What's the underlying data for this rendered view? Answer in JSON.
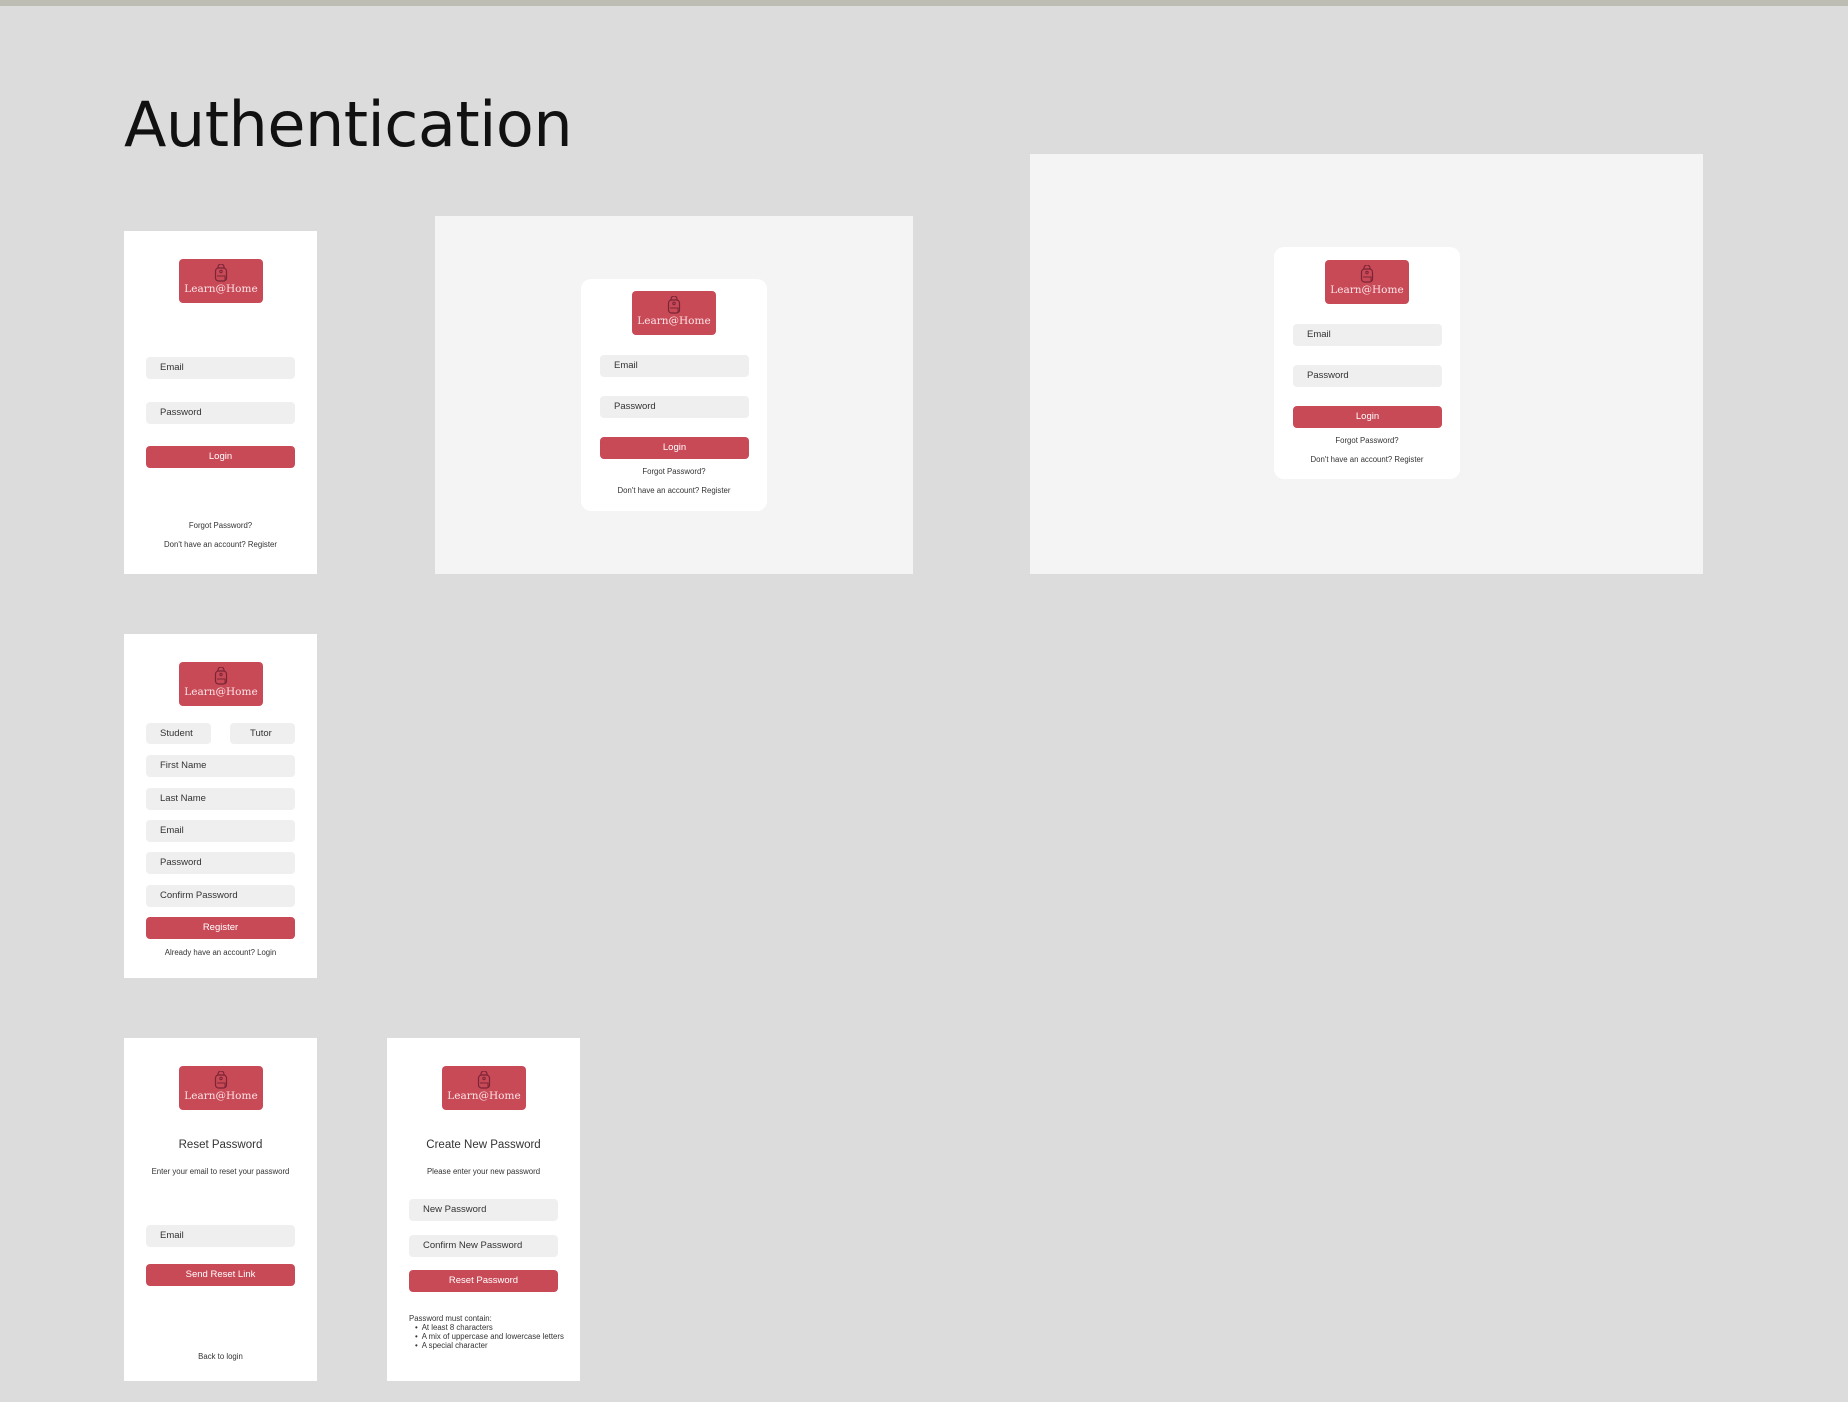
{
  "page_title": "Authentication",
  "brand": {
    "name": "Learn@Home",
    "logo_icon": "backpack-icon",
    "accent": "#c94a57"
  },
  "login": {
    "email_placeholder": "Email",
    "password_placeholder": "Password",
    "login_label": "Login",
    "forgot_label": "Forgot Password?",
    "register_link": "Don't have an account? Register"
  },
  "register": {
    "student_label": "Student",
    "tutor_label": "Tutor",
    "first_name": "First Name",
    "last_name": "Last Name",
    "email": "Email",
    "password": "Password",
    "confirm_password": "Confirm Password",
    "register_label": "Register",
    "login_link": "Already have an account? Login"
  },
  "reset": {
    "title": "Reset Password",
    "subtitle": "Enter your email to reset your password",
    "email": "Email",
    "send_label": "Send Reset Link",
    "back_link": "Back to login"
  },
  "create_password": {
    "title": "Create New Password",
    "subtitle": "Please enter your new password",
    "new_password": "New Password",
    "confirm_new_password": "Confirm New Password",
    "reset_label": "Reset Password",
    "rules_title": "Password must contain:",
    "rules": [
      "At least 8 characters",
      "A mix of uppercase and lowercase letters",
      "A special character"
    ]
  }
}
